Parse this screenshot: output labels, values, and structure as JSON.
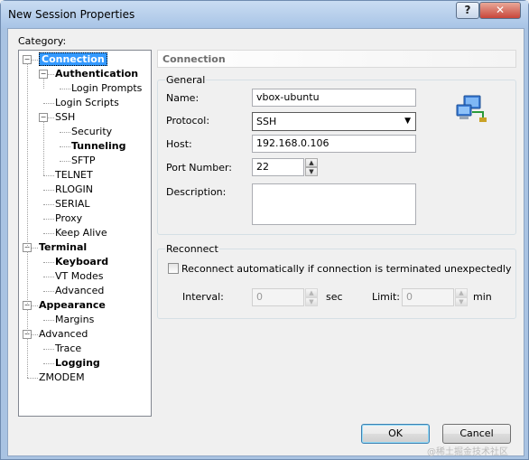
{
  "window": {
    "title": "New Session Properties",
    "help_glyph": "?",
    "close_glyph": "✕"
  },
  "category": {
    "label": "Category:",
    "tree": [
      {
        "label": "Connection",
        "expander": "⊟",
        "bold": true,
        "selected": true
      },
      {
        "label": "Authentication",
        "expander": "⊟",
        "bold": true
      },
      {
        "label": "Login Prompts"
      },
      {
        "label": "Login Scripts"
      },
      {
        "label": "SSH",
        "expander": "⊟"
      },
      {
        "label": "Security"
      },
      {
        "label": "Tunneling",
        "bold": true
      },
      {
        "label": "SFTP"
      },
      {
        "label": "TELNET"
      },
      {
        "label": "RLOGIN"
      },
      {
        "label": "SERIAL"
      },
      {
        "label": "Proxy"
      },
      {
        "label": "Keep Alive"
      },
      {
        "label": "Terminal",
        "expander": "⊟",
        "bold": true
      },
      {
        "label": "Keyboard",
        "bold": true
      },
      {
        "label": "VT Modes"
      },
      {
        "label": "Advanced"
      },
      {
        "label": "Appearance",
        "expander": "⊟",
        "bold": true
      },
      {
        "label": "Margins"
      },
      {
        "label": "Advanced",
        "expander": "⊟"
      },
      {
        "label": "Trace"
      },
      {
        "label": "Logging",
        "bold": true
      },
      {
        "label": "ZMODEM"
      }
    ]
  },
  "panel": {
    "header": "Connection",
    "general": {
      "title": "General",
      "name_label": "Name:",
      "name_value": "vbox-ubuntu",
      "protocol_label": "Protocol:",
      "protocol_value": "SSH",
      "host_label": "Host:",
      "host_value": "192.168.0.106",
      "port_label": "Port Number:",
      "port_value": "22",
      "description_label": "Description:",
      "description_value": ""
    },
    "reconnect": {
      "title": "Reconnect",
      "checkbox_label": "Reconnect automatically if connection is terminated unexpectedly",
      "checked": false,
      "interval_label": "Interval:",
      "interval_value": "0",
      "interval_unit": "sec",
      "limit_label": "Limit:",
      "limit_value": "0",
      "limit_unit": "min"
    }
  },
  "buttons": {
    "ok": "OK",
    "cancel": "Cancel"
  },
  "watermark": "@稀土掘金技术社区",
  "icons": [
    "network-computers-icon",
    "help-icon",
    "close-icon",
    "dropdown-arrow-icon"
  ]
}
